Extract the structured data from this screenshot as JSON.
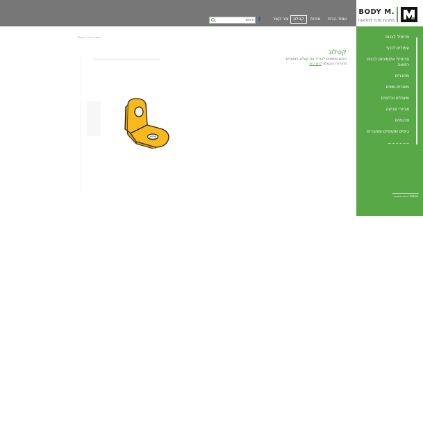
{
  "header": {
    "logo_text": "BODY M.",
    "logo_tagline": "מתכות מדף למלאות",
    "nav": [
      {
        "label": "עמוד הבית",
        "active": false
      },
      {
        "label": "אודות",
        "active": false
      },
      {
        "label": "קטלוג",
        "active": true
      },
      {
        "label": "צור קשר",
        "active": false
      }
    ],
    "search_placeholder": "חיפוש",
    "facebook_icon": "facebook-icon",
    "search_icon": "search-icon"
  },
  "sidebar": {
    "items": [
      {
        "label": "פרופיל לבנות"
      },
      {
        "label": "עמודים לנדף"
      },
      {
        "label": "פרופילי אלומיניום לבנים רפואה"
      },
      {
        "label": "מחברים"
      },
      {
        "label": "מוצרים שונים"
      },
      {
        "label": "שינגלים ובלוטים"
      },
      {
        "label": "אביזרי צביעה"
      },
      {
        "label": "סכנפוים"
      },
      {
        "label": "ביסים שקעניים ומחברים"
      }
    ],
    "footer": "בניית אתרים: Kokos"
  },
  "main": {
    "breadcrumb": "עמוד הבית › קטלוג",
    "title": "קטלוג",
    "description_line1": "הנכם מוזמנים להוריד את קטלוג המוצרים",
    "description_line2_prefix": "להורדת הקטלוג ",
    "description_link": "לחץ כאן",
    "image": "l-bracket-image"
  },
  "colors": {
    "brand_green": "#58a847",
    "header_gray": "#777777",
    "bracket_yellow": "#f8b91c"
  }
}
